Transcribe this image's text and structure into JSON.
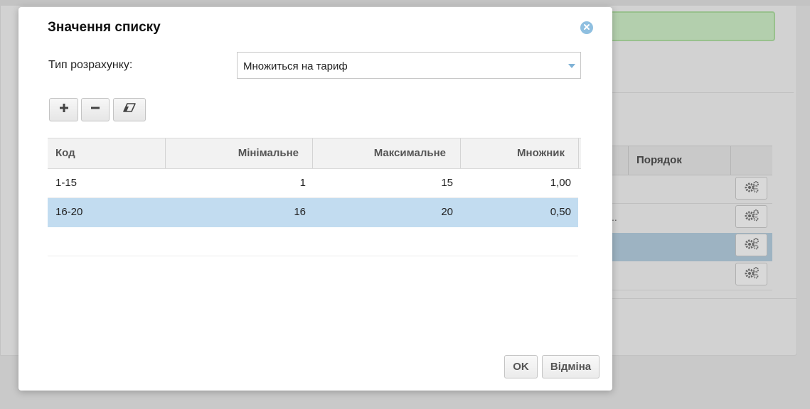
{
  "dialog": {
    "title": "Значення списку",
    "calc_type_label": "Тип розрахунку:",
    "calc_type_value": "Множиться на тариф",
    "toolbar": {
      "add_icon": "plus-icon",
      "remove_icon": "minus-icon",
      "clear_icon": "eraser-icon"
    },
    "grid": {
      "columns": [
        "Код",
        "Мінімальне",
        "Максимальне",
        "Множник"
      ],
      "rows": [
        {
          "code": "1-15",
          "min": "1",
          "max": "15",
          "mult": "1,00",
          "selected": false
        },
        {
          "code": "16-20",
          "min": "16",
          "max": "20",
          "mult": "0,50",
          "selected": true
        }
      ]
    },
    "ok_label": "OK",
    "cancel_label": "Відміна"
  },
  "background": {
    "table_header": "Порядок",
    "ellipsis": "..",
    "row_action_icon": "gears-icon"
  },
  "colors": {
    "selection": "#c2dcf0",
    "accent": "#7fb2d6",
    "success_bar": "#b3cfad"
  }
}
